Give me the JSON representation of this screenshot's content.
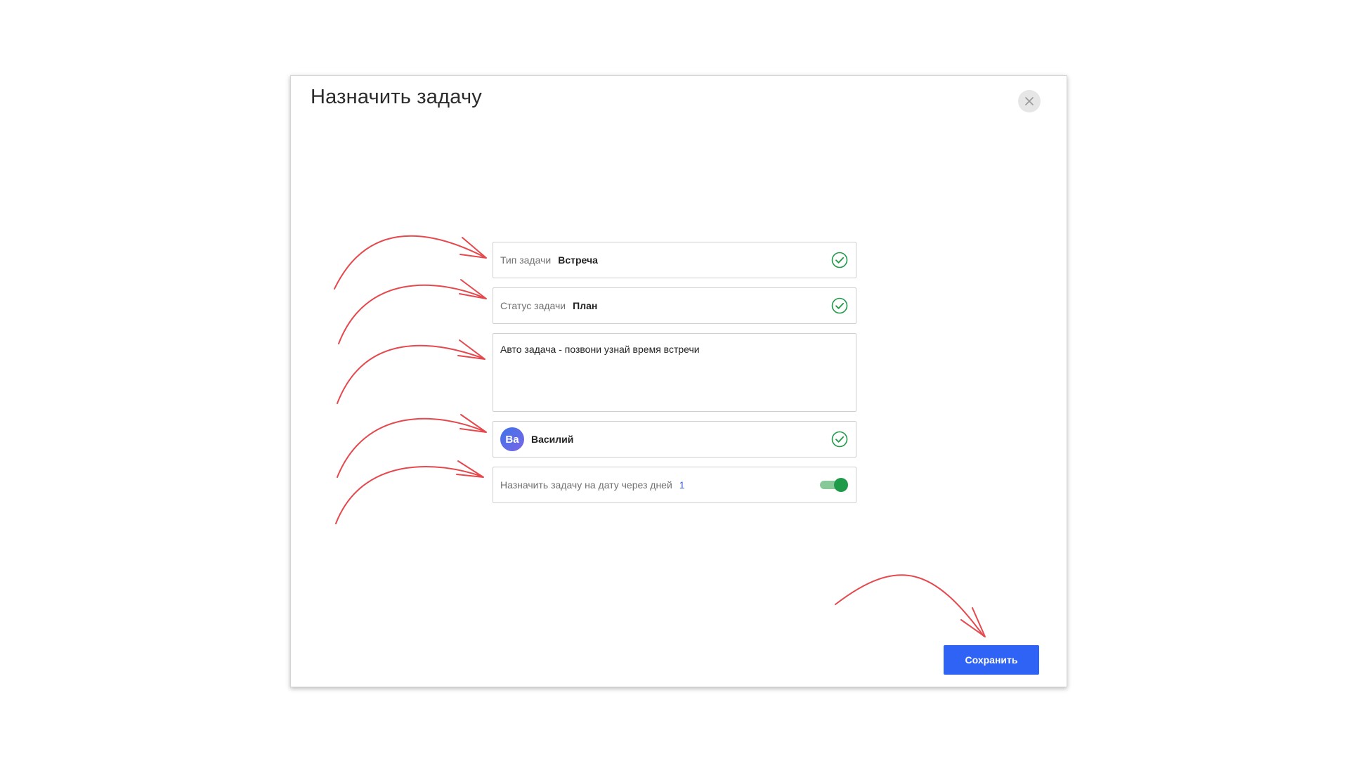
{
  "dialog": {
    "title": "Назначить задачу",
    "close_icon": "close-icon"
  },
  "form": {
    "task_type": {
      "label": "Тип задачи",
      "value": "Встреча",
      "status_icon": "check-circle-icon"
    },
    "task_status": {
      "label": "Статус задачи",
      "value": "План",
      "status_icon": "check-circle-icon"
    },
    "description": {
      "value": "Авто задача - позвони узнай время встречи"
    },
    "assignee": {
      "avatar_initials": "Ва",
      "name": "Василий",
      "status_icon": "check-circle-icon"
    },
    "schedule": {
      "label": "Назначить задачу на дату через дней",
      "days": "1",
      "toggle_on": true
    }
  },
  "footer": {
    "save_label": "Сохранить"
  },
  "colors": {
    "accent": "#2f63f5",
    "success": "#1f9a48",
    "annotation": "#e5484d"
  }
}
